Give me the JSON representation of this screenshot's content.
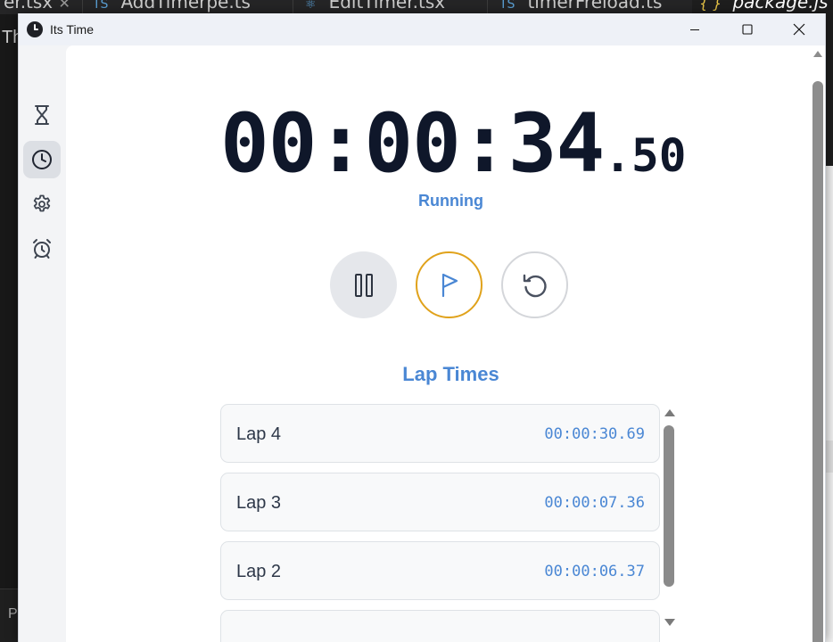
{
  "background_editor": {
    "tabs": [
      "er.tsx",
      "AddTimerpe.ts",
      "EditTimer.tsx",
      "timerFreload.ts",
      "package.js"
    ],
    "left_text": "Th",
    "left_bottom_text": "P"
  },
  "window": {
    "title": "Its Time",
    "controls": {
      "minimize_icon": "minimize-icon",
      "maximize_icon": "maximize-icon",
      "close_icon": "close-icon"
    }
  },
  "sidebar": {
    "items": [
      {
        "id": "timer",
        "icon": "hourglass-icon",
        "active": false
      },
      {
        "id": "stopwatch",
        "icon": "clock-icon",
        "active": true
      },
      {
        "id": "settings",
        "icon": "gear-icon",
        "active": false
      },
      {
        "id": "alarm",
        "icon": "alarm-clock-icon",
        "active": false
      }
    ]
  },
  "stopwatch": {
    "time_main": "00:00:34",
    "time_fraction": ".50",
    "status": "Running",
    "controls": {
      "pause_icon": "pause-icon",
      "lap_icon": "flag-icon",
      "reset_icon": "reset-icon"
    },
    "laps_heading": "Lap Times",
    "laps": [
      {
        "label": "Lap 4",
        "time": "00:00:30.69"
      },
      {
        "label": "Lap 3",
        "time": "00:00:07.36"
      },
      {
        "label": "Lap 2",
        "time": "00:00:06.37"
      },
      {
        "label": "",
        "time": ""
      }
    ]
  },
  "colors": {
    "accent": "#4a87d4",
    "time_text": "#0f172a",
    "lap_button_border": "#e0a21b",
    "active_nav_bg": "#dcdfe4"
  }
}
